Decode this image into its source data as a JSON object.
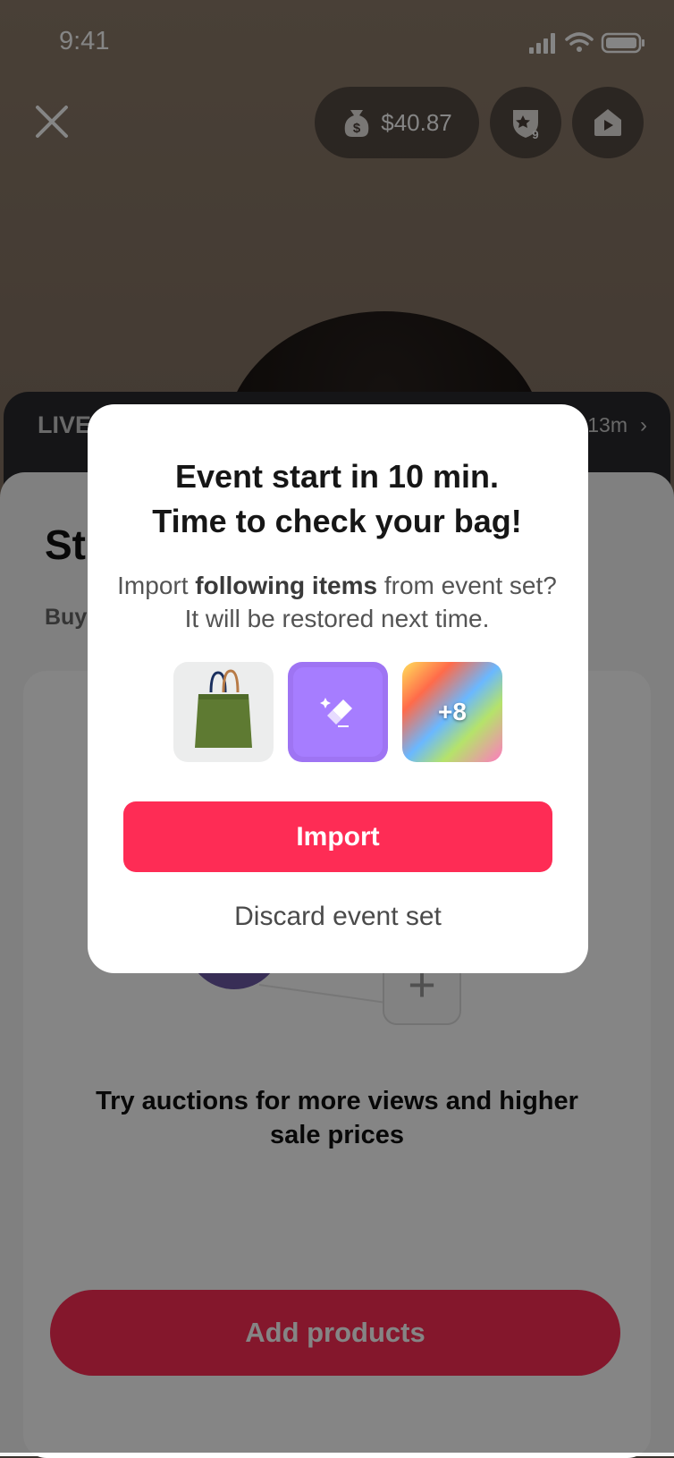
{
  "status_bar": {
    "time": "9:41"
  },
  "header": {
    "balance": "$40.87",
    "badge_count": "9"
  },
  "live_bar": {
    "label": "LIVE",
    "time": "13m"
  },
  "sheet": {
    "title": "St",
    "subtitle": "Buy",
    "promo": "Try auctions for more views and higher sale prices",
    "add_products_label": "Add products"
  },
  "modal": {
    "title_line1": "Event start in 10 min.",
    "title_line2": "Time to check your bag!",
    "body_prefix": "Import ",
    "body_bold": "following items",
    "body_suffix": " from event set? It will be restored next time.",
    "more_items": "+8",
    "import_label": "Import",
    "discard_label": "Discard event set"
  },
  "colors": {
    "accent": "#fe2c55",
    "purple": "#9e74f3"
  }
}
